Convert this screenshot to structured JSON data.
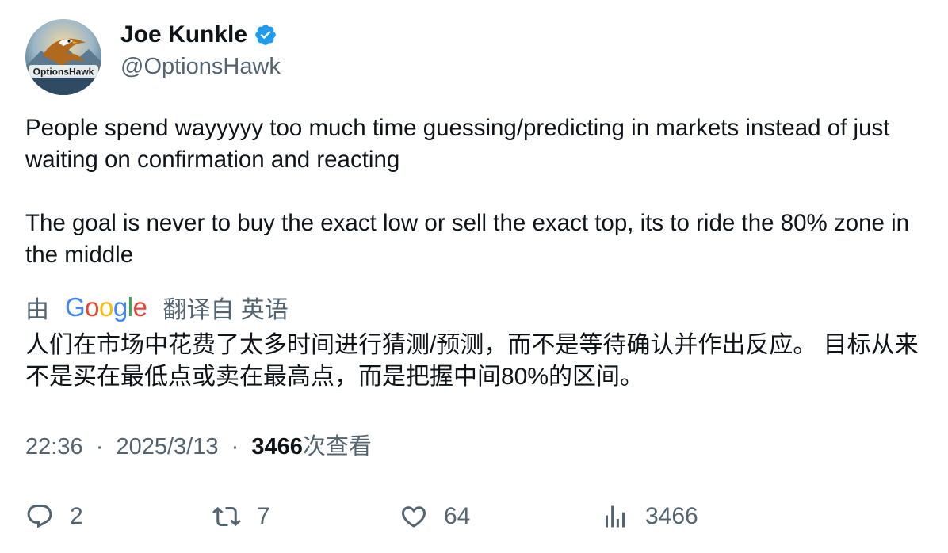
{
  "author": {
    "name": "Joe Kunkle",
    "handle": "@OptionsHawk",
    "verified": true,
    "avatar_logo_text": "OptionsHawk"
  },
  "tweet": {
    "paragraphs": [
      "People spend wayyyyy too much time guessing/predicting in markets instead of just waiting on confirmation and reacting",
      "The goal is never to buy the exact low or sell the exact top, its to ride the 80% zone in the middle"
    ]
  },
  "translation": {
    "by_label": "由",
    "provider": "Google",
    "from_label": "翻译自 英语",
    "text": "人们在市场中花费了太多时间进行猜测/预测，而不是等待确认并作出反应。 目标从来不是买在最低点或卖在最高点，而是把握中间80%的区间。"
  },
  "meta": {
    "time": "22:36",
    "separator": "·",
    "date": "2025/3/13",
    "views": "3466",
    "views_label": "次查看"
  },
  "actions": {
    "replies": "2",
    "reposts": "7",
    "likes": "64",
    "views": "3466"
  },
  "colors": {
    "text": "#0f1419",
    "secondary": "#536471",
    "verified": "#1d9bf0",
    "google_blue": "#4285F4",
    "google_red": "#EA4335",
    "google_yellow": "#FBBC05",
    "google_green": "#34A853"
  },
  "icons": [
    "verified-badge-icon",
    "reply-icon",
    "repost-icon",
    "like-icon",
    "views-icon"
  ]
}
